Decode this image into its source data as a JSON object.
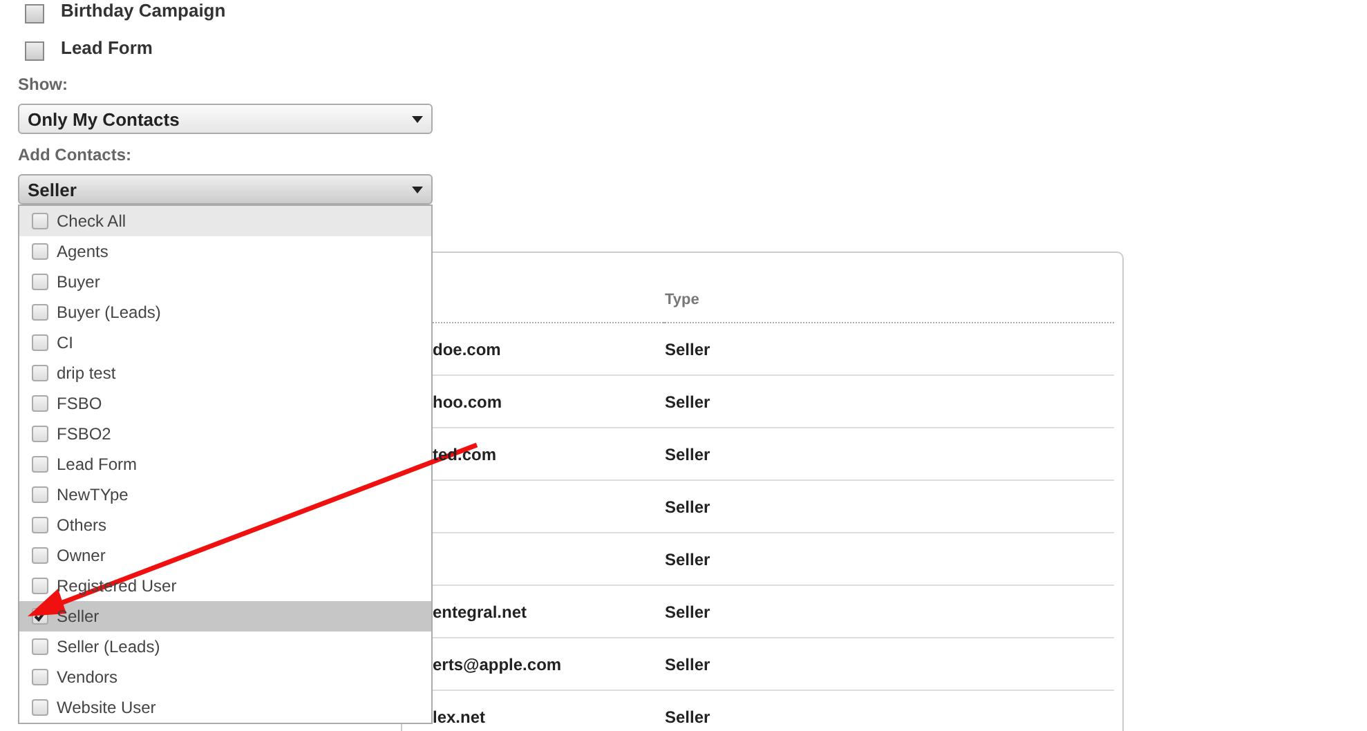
{
  "campaigns": [
    {
      "label": "Birthday Campaign",
      "checked": false
    },
    {
      "label": "Lead Form",
      "checked": false
    }
  ],
  "show": {
    "label": "Show:",
    "value": "Only My Contacts"
  },
  "add_contacts": {
    "label": "Add Contacts:",
    "value": "Seller",
    "expanded": true,
    "options": [
      {
        "label": "Check All",
        "kind": "check_all",
        "checked": false
      },
      {
        "label": "Agents",
        "kind": "option",
        "checked": false
      },
      {
        "label": "Buyer",
        "kind": "option",
        "checked": false
      },
      {
        "label": "Buyer (Leads)",
        "kind": "option",
        "checked": false
      },
      {
        "label": "CI",
        "kind": "option",
        "checked": false
      },
      {
        "label": "drip test",
        "kind": "option",
        "checked": false
      },
      {
        "label": "FSBO",
        "kind": "option",
        "checked": false
      },
      {
        "label": "FSBO2",
        "kind": "option",
        "checked": false
      },
      {
        "label": "Lead Form",
        "kind": "option",
        "checked": false
      },
      {
        "label": "NewTYpe",
        "kind": "option",
        "checked": false
      },
      {
        "label": "Others",
        "kind": "option",
        "checked": false
      },
      {
        "label": "Owner",
        "kind": "option",
        "checked": false
      },
      {
        "label": "Registered User",
        "kind": "option",
        "checked": false
      },
      {
        "label": "Seller",
        "kind": "option",
        "checked": true
      },
      {
        "label": "Seller (Leads)",
        "kind": "option",
        "checked": false
      },
      {
        "label": "Vendors",
        "kind": "option",
        "checked": false
      },
      {
        "label": "Website User",
        "kind": "option",
        "checked": false
      }
    ]
  },
  "table": {
    "columns": [
      "Type"
    ],
    "rows": [
      {
        "email": "doe.com",
        "type": "Seller"
      },
      {
        "email": "hoo.com",
        "type": "Seller"
      },
      {
        "email": "ted.com",
        "type": "Seller"
      },
      {
        "email": "",
        "type": "Seller"
      },
      {
        "email": "",
        "type": "Seller"
      },
      {
        "email": "entegral.net",
        "type": "Seller"
      },
      {
        "email": "erts@apple.com",
        "type": "Seller"
      },
      {
        "email": "lex.net",
        "type": "Seller"
      }
    ]
  },
  "annotation": {
    "kind": "arrow"
  }
}
